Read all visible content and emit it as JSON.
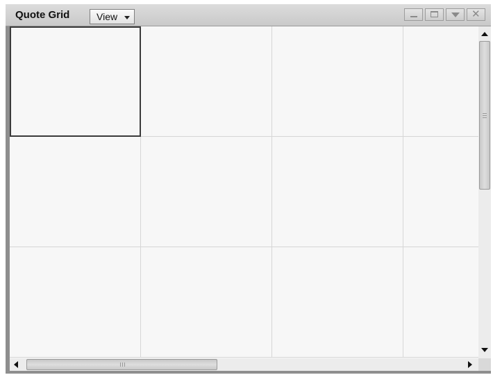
{
  "window": {
    "title": "Quote Grid",
    "view_menu_label": "View",
    "controls": [
      "minimize-icon",
      "maximize-icon",
      "dropdown-icon",
      "close-icon"
    ],
    "close_glyph": "✕"
  },
  "grid": {
    "rows": 3,
    "columns": 4,
    "selected_cell": {
      "row": 1,
      "column": 1
    },
    "cells_empty": true
  },
  "scrollbars": {
    "vertical": {
      "position_fraction": 0.0
    },
    "horizontal": {
      "position_fraction": 0.0
    }
  },
  "colors": {
    "frame": "#8e8e8e",
    "titlebar": "#d3d3d3",
    "cell_background": "#f7f7f7",
    "grid_lines": "#d6d6d6",
    "selection_border": "#3a3a3a"
  }
}
